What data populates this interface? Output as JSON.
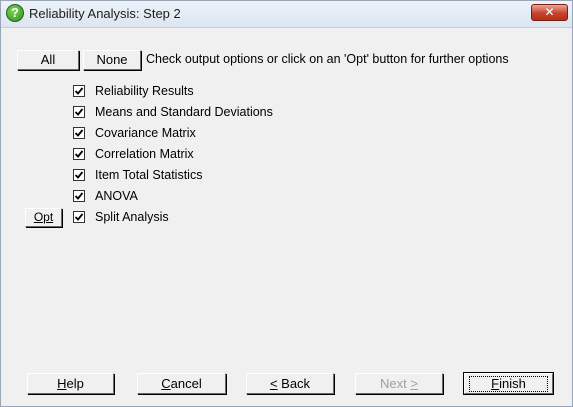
{
  "window": {
    "title": "Reliability Analysis: Step 2",
    "close_glyph": "✕"
  },
  "toolbar": {
    "all_label": "All",
    "none_label": "None",
    "instruction": "Check output options or click on an 'Opt' button for further options"
  },
  "options": [
    {
      "label": "Reliability Results",
      "checked": true
    },
    {
      "label": "Means and Standard Deviations",
      "checked": true
    },
    {
      "label": "Covariance Matrix",
      "checked": true
    },
    {
      "label": "Correlation Matrix",
      "checked": true
    },
    {
      "label": "Item Total Statistics",
      "checked": true
    },
    {
      "label": "ANOVA",
      "checked": true
    },
    {
      "label": "Split Analysis",
      "checked": true
    }
  ],
  "opt_button_label": "Opt",
  "footer": {
    "help": {
      "prefix": "",
      "mnemonic": "H",
      "rest": "elp"
    },
    "cancel": {
      "prefix": "",
      "mnemonic": "C",
      "rest": "ancel"
    },
    "back": {
      "prefix": "",
      "mnemonic": "<",
      "rest": " Back"
    },
    "next": {
      "prefix": "Next ",
      "mnemonic": ">",
      "rest": ""
    },
    "finish": {
      "prefix": "",
      "mnemonic": "F",
      "rest": "inish"
    }
  },
  "icons": {
    "title_icon": "question-icon",
    "close": "close-icon",
    "checkbox_mark": "checkmark-icon"
  }
}
